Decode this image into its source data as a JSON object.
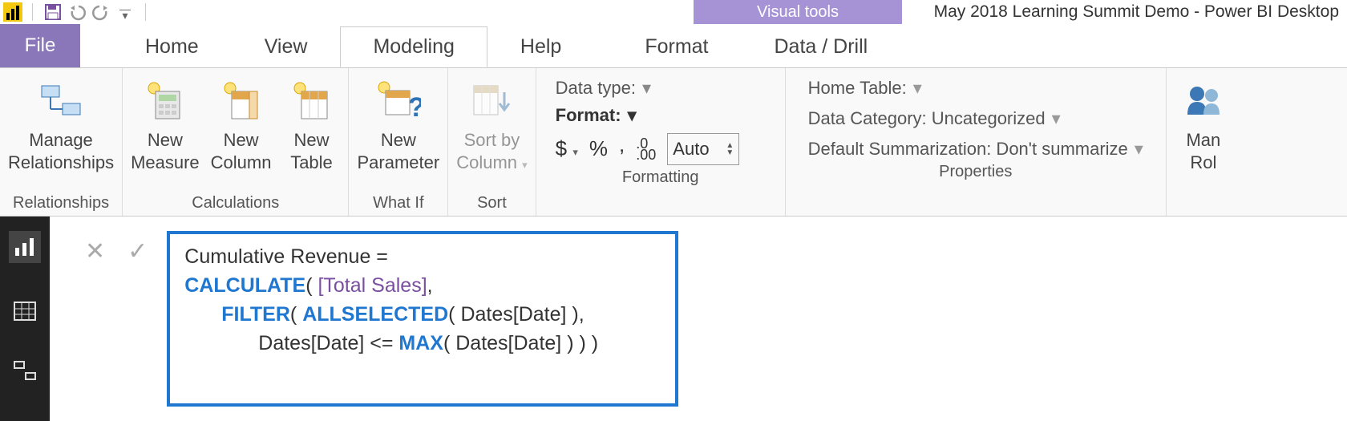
{
  "titlebar": {
    "context_tab": "Visual tools",
    "window_title": "May 2018 Learning Summit Demo - Power BI Desktop"
  },
  "tabs": {
    "file": "File",
    "items": [
      "Home",
      "View",
      "Modeling",
      "Help",
      "Format",
      "Data / Drill"
    ],
    "active_index": 2
  },
  "ribbon": {
    "relationships": {
      "button": "Manage\nRelationships",
      "group_label": "Relationships"
    },
    "calculations": {
      "buttons": [
        "New\nMeasure",
        "New\nColumn",
        "New\nTable"
      ],
      "group_label": "Calculations"
    },
    "whatif": {
      "button": "New\nParameter",
      "group_label": "What If"
    },
    "sort": {
      "button": "Sort by\nColumn",
      "group_label": "Sort"
    },
    "formatting": {
      "data_type_label": "Data type:",
      "format_label": "Format:",
      "currency": "$",
      "percent": "%",
      "comma": ",",
      "decimal_icon": ".00",
      "auto": "Auto",
      "group_label": "Formatting"
    },
    "properties": {
      "home_table": "Home Table:",
      "data_category": "Data Category: Uncategorized",
      "default_summarization": "Default Summarization: Don't summarize",
      "group_label": "Properties"
    },
    "security": {
      "button": "Man\nRol"
    }
  },
  "formula": {
    "line1_prefix": "Cumulative Revenue =",
    "calc": "CALCULATE",
    "paren_open": "(",
    "measure": " [Total Sales]",
    "comma1": ",",
    "filter": "FILTER",
    "allselected": "ALLSELECTED",
    "dates_date": "Dates[Date]",
    "close_comma": " ),",
    "le": " <= ",
    "max": "MAX",
    "close_all": " ) ) )",
    "paren_close_a": " )"
  }
}
